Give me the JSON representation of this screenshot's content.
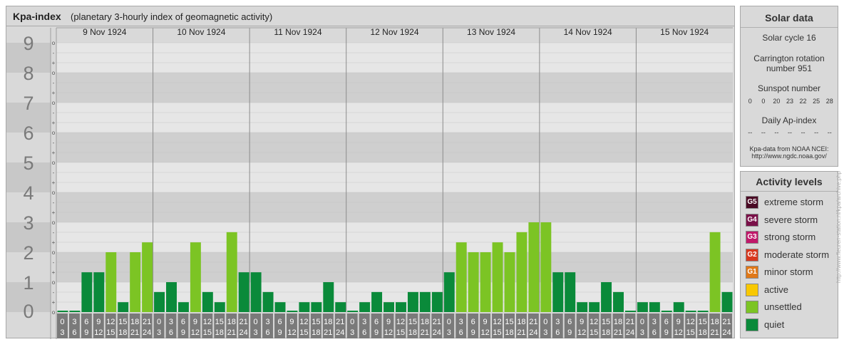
{
  "header": {
    "title": "Kpa-index",
    "subtitle": "(planetary 3-hourly index of geomagnetic activity)"
  },
  "solar": {
    "title": "Solar data",
    "cycle": "Solar cycle 16",
    "carrington_line1": "Carrington rotation",
    "carrington_line2": "number 951",
    "sunspot_title": "Sunspot number",
    "sunspot_values": [
      "0",
      "0",
      "20",
      "23",
      "22",
      "25",
      "28"
    ],
    "ap_title": "Daily Ap-index",
    "ap_values": [
      "--",
      "--",
      "--",
      "--",
      "--",
      "--",
      "--"
    ],
    "source_line1": "Kpa-data from NOAA NCEI:",
    "source_line2": "http://www.ngdc.noaa.gov/"
  },
  "activity": {
    "title": "Activity levels",
    "levels": [
      {
        "badge": "G5",
        "label": "extreme storm",
        "color": "#4a0a24"
      },
      {
        "badge": "G4",
        "label": "severe storm",
        "color": "#7a1048"
      },
      {
        "badge": "G3",
        "label": "strong storm",
        "color": "#c0186a"
      },
      {
        "badge": "G2",
        "label": "moderate storm",
        "color": "#d8381e"
      },
      {
        "badge": "G1",
        "label": "minor storm",
        "color": "#e07818"
      },
      {
        "badge": "",
        "label": "active",
        "color": "#f8c800"
      },
      {
        "badge": "",
        "label": "unsettled",
        "color": "#7cc424"
      },
      {
        "badge": "",
        "label": "quiet",
        "color": "#0a8a3a"
      }
    ]
  },
  "watermark": "http://www.fleuren-station.nl/kpa/archive.php",
  "chart_data": {
    "type": "bar",
    "title": "Kpa-index",
    "ylabel": "",
    "ylim": [
      0,
      9
    ],
    "y_ticks": [
      "0",
      "1",
      "2",
      "3",
      "4",
      "5",
      "6",
      "7",
      "8",
      "9"
    ],
    "sub_ticks": [
      "o",
      "+",
      "-",
      "o",
      "+",
      "-",
      "o",
      "+",
      "-",
      "o",
      "+",
      "-",
      "o",
      "+",
      "-",
      "o",
      "+",
      "-",
      "o",
      "+",
      "-",
      "o",
      "+",
      "-",
      "o",
      "+",
      "-",
      "o"
    ],
    "days": [
      "9 Nov 1924",
      "10 Nov 1924",
      "11 Nov 1924",
      "12 Nov 1924",
      "13 Nov 1924",
      "14 Nov 1924",
      "15 Nov 1924"
    ],
    "interval_starts": [
      "0",
      "3",
      "6",
      "9",
      "12",
      "15",
      "18",
      "21"
    ],
    "interval_ends": [
      "3",
      "6",
      "9",
      "12",
      "15",
      "18",
      "21",
      "24"
    ],
    "series": [
      {
        "values": [
          0.0,
          0.0,
          1.33,
          1.33,
          2.0,
          0.33,
          2.0,
          2.33,
          0.67,
          1.0,
          0.33,
          2.33,
          0.67,
          0.33,
          2.67,
          1.33,
          1.33,
          0.67,
          0.33,
          0.0,
          0.33,
          0.33,
          1.0,
          0.33,
          0.0,
          0.33,
          0.67,
          0.33,
          0.33,
          0.67,
          0.67,
          0.67,
          1.33,
          2.33,
          2.0,
          2.0,
          2.33,
          2.0,
          2.67,
          3.0,
          3.0,
          1.33,
          1.33,
          0.33,
          0.33,
          1.0,
          0.67,
          0.0,
          0.33,
          0.33,
          0.0,
          0.33,
          0.0,
          0.0,
          2.67,
          0.67
        ]
      }
    ],
    "colors": {
      "quiet": "#0a8a3a",
      "unsettled": "#7cc424",
      "active": "#f8c800"
    }
  }
}
